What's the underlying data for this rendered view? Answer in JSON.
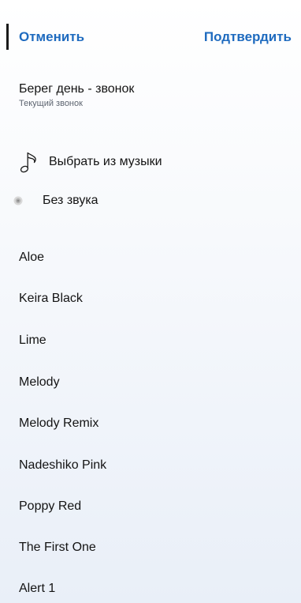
{
  "header": {
    "cancel_label": "Отменить",
    "confirm_label": "Подтвердить"
  },
  "current": {
    "title": "Берег день - звонок",
    "subtitle": "Текущий звонок"
  },
  "actions": {
    "pick_music_label": "Выбрать из музыки",
    "pick_music_icon": "music-note-icon",
    "silent_label": "Без звука",
    "silent_icon": "mute-icon"
  },
  "ringtones": [
    "Aloe",
    "Keira Black",
    "Lime",
    "Melody",
    "Melody Remix",
    "Nadeshiko Pink",
    "Poppy Red",
    "The First One",
    "Alert 1"
  ],
  "colors": {
    "accent": "#1f6bbf",
    "text": "#141414",
    "subtext": "#5d6470"
  }
}
